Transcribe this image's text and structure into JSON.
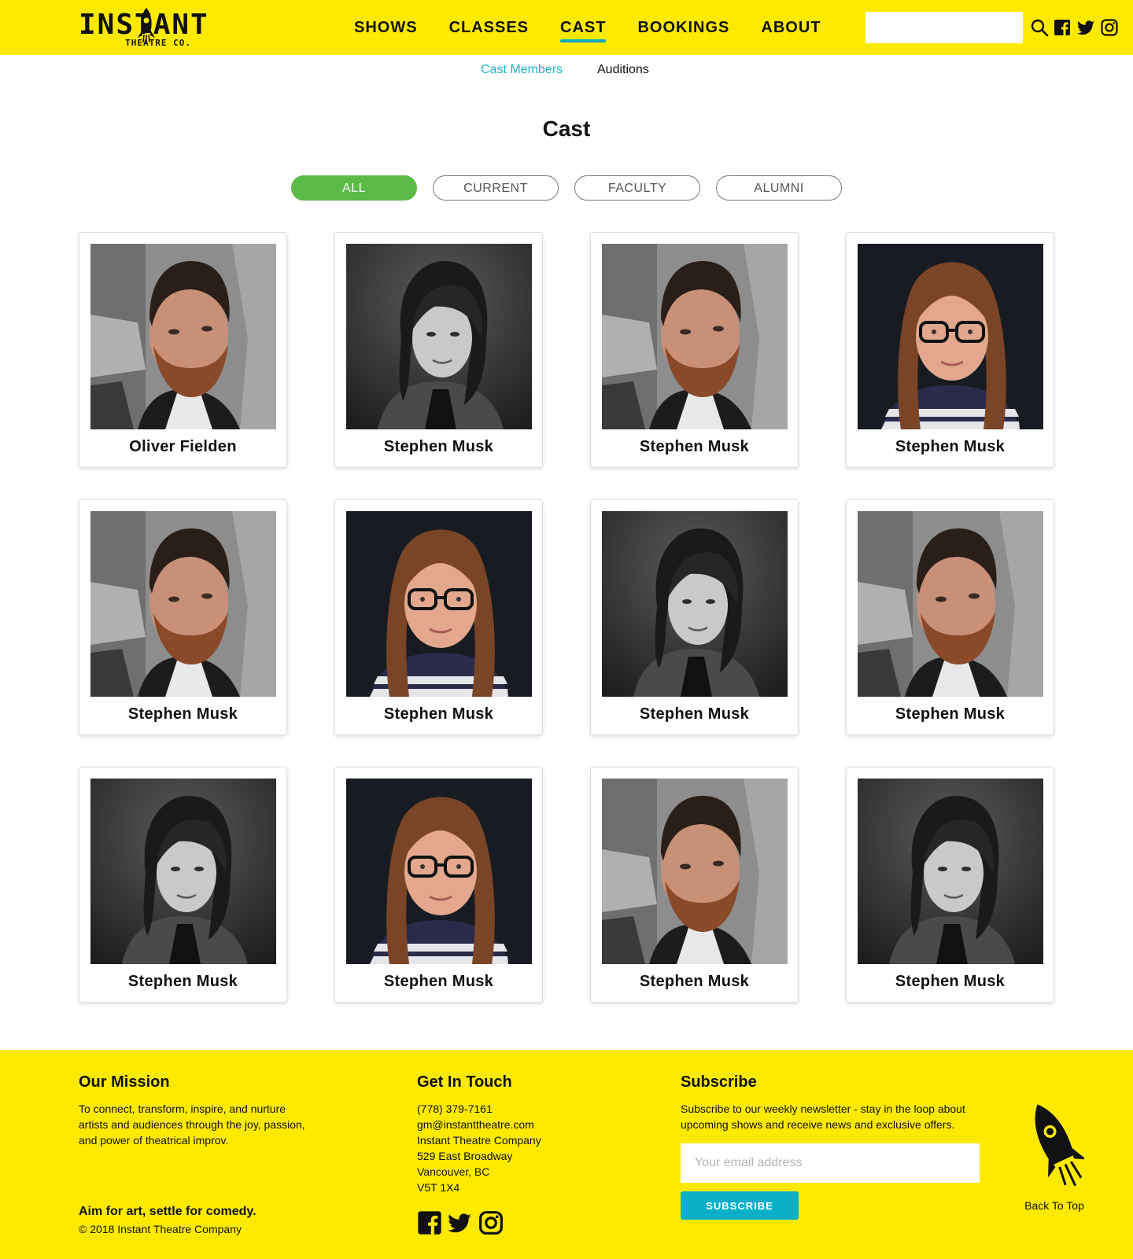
{
  "brand": {
    "logo_main": "INSTANT",
    "logo_sub": "THEATRE CO."
  },
  "nav": {
    "items": [
      {
        "label": "SHOWS"
      },
      {
        "label": "CLASSES"
      },
      {
        "label": "CAST"
      },
      {
        "label": "BOOKINGS"
      },
      {
        "label": "ABOUT"
      }
    ],
    "active": "CAST"
  },
  "search": {
    "value": "",
    "placeholder": ""
  },
  "subnav": {
    "items": [
      {
        "label": "Cast Members"
      },
      {
        "label": "Auditions"
      }
    ],
    "active": "Cast Members"
  },
  "page": {
    "title": "Cast"
  },
  "filters": {
    "items": [
      {
        "label": "ALL"
      },
      {
        "label": "CURRENT"
      },
      {
        "label": "FACULTY"
      },
      {
        "label": "ALUMNI"
      }
    ],
    "active": "ALL"
  },
  "cast": [
    {
      "name": "Oliver Fielden",
      "photo": "bearded-man-portrait"
    },
    {
      "name": "Stephen Musk",
      "photo": "bw-woman-portrait"
    },
    {
      "name": "Stephen Musk",
      "photo": "bearded-man-portrait"
    },
    {
      "name": "Stephen Musk",
      "photo": "woman-glasses-portrait"
    },
    {
      "name": "Stephen Musk",
      "photo": "bearded-man-portrait"
    },
    {
      "name": "Stephen Musk",
      "photo": "woman-glasses-portrait"
    },
    {
      "name": "Stephen Musk",
      "photo": "bw-woman-portrait"
    },
    {
      "name": "Stephen Musk",
      "photo": "bearded-man-portrait"
    },
    {
      "name": "Stephen Musk",
      "photo": "bw-woman-portrait"
    },
    {
      "name": "Stephen Musk",
      "photo": "woman-glasses-portrait"
    },
    {
      "name": "Stephen Musk",
      "photo": "bearded-man-portrait"
    },
    {
      "name": "Stephen Musk",
      "photo": "bw-woman-portrait"
    }
  ],
  "footer": {
    "mission": {
      "heading": "Our Mission",
      "lines": [
        "To connect, transform, inspire, and nurture",
        "artists and audiences through the joy, passion,",
        "and power of theatrical improv."
      ]
    },
    "contact": {
      "heading": "Get In Touch",
      "lines": [
        "(778) 379-7161",
        "gm@instanttheatre.com",
        "Instant Theatre Company",
        "529 East Broadway",
        "Vancouver, BC",
        "V5T 1X4"
      ]
    },
    "subscribe": {
      "heading": "Subscribe",
      "lines": [
        "Subscribe to our weekly newsletter - stay in the loop about",
        "upcoming shows and receive news and exclusive offers."
      ],
      "email_placeholder": "Your email address",
      "button_label": "SUBSCRIBE"
    },
    "tagline": "Aim for art, settle for comedy.",
    "copyright": "© 2018 Instant Theatre Company",
    "back_to_top": "Back To Top"
  },
  "colors": {
    "brand_yellow": "#fdea00",
    "accent_teal": "#0aa9bf",
    "filter_active_green": "#5cba47"
  },
  "icons": [
    "rocket-icon",
    "search-icon",
    "facebook-icon",
    "twitter-icon",
    "instagram-icon"
  ]
}
